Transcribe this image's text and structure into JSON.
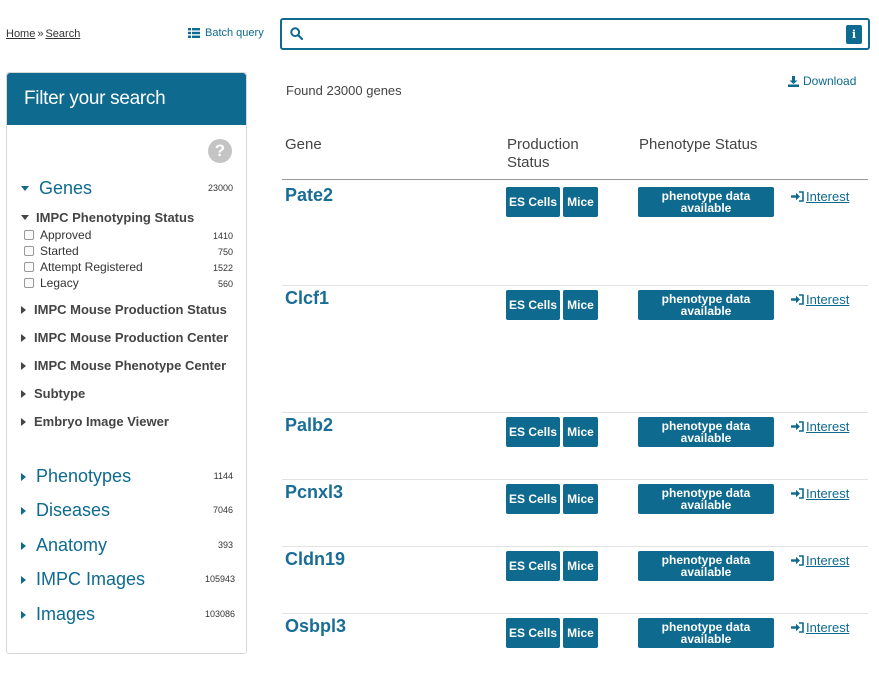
{
  "breadcrumb": {
    "home": "Home",
    "sep": "»",
    "current": "Search"
  },
  "batch_query": {
    "label": "Batch query",
    "icon": "list-icon"
  },
  "search": {
    "value": "",
    "placeholder": "",
    "info_label": "i"
  },
  "filter": {
    "title": "Filter your search",
    "help_label": "?",
    "genes": {
      "label": "Genes",
      "count": "23000"
    },
    "phenotyping_status": {
      "label": "IMPC Phenotyping Status",
      "options": [
        {
          "label": "Approved",
          "count": "1410"
        },
        {
          "label": "Started",
          "count": "750"
        },
        {
          "label": "Attempt Registered",
          "count": "1522"
        },
        {
          "label": "Legacy",
          "count": "560"
        }
      ]
    },
    "subfilters": [
      "IMPC Mouse Production Status",
      "IMPC Mouse Production Center",
      "IMPC Mouse Phenotype Center",
      "Subtype",
      "Embryo Image Viewer"
    ],
    "cores": [
      {
        "label": "Phenotypes",
        "count": "1144"
      },
      {
        "label": "Diseases",
        "count": "7046"
      },
      {
        "label": "Anatomy",
        "count": "393"
      },
      {
        "label": "IMPC Images",
        "count": "105943"
      },
      {
        "label": "Images",
        "count": "103086"
      }
    ]
  },
  "results": {
    "found_text": "Found 23000 genes",
    "download_label": "Download",
    "columns": {
      "gene": "Gene",
      "production_line1": "Production",
      "production_line2": "Status",
      "phenotype": "Phenotype Status"
    },
    "rows": [
      {
        "gene": "Pate2",
        "es": "ES Cells",
        "mice": "Mice",
        "pheno_line1": "phenotype data",
        "pheno_line2": "available",
        "interest": "Interest"
      },
      {
        "gene": "Clcf1",
        "es": "ES Cells",
        "mice": "Mice",
        "pheno_line1": "phenotype data",
        "pheno_line2": "available",
        "interest": "Interest"
      },
      {
        "gene": "Palb2",
        "es": "ES Cells",
        "mice": "Mice",
        "pheno_line1": "phenotype data",
        "pheno_line2": "available",
        "interest": "Interest"
      },
      {
        "gene": "Pcnxl3",
        "es": "ES Cells",
        "mice": "Mice",
        "pheno_line1": "phenotype data",
        "pheno_line2": "available",
        "interest": "Interest"
      },
      {
        "gene": "Cldn19",
        "es": "ES Cells",
        "mice": "Mice",
        "pheno_line1": "phenotype data",
        "pheno_line2": "available",
        "interest": "Interest"
      },
      {
        "gene": "Osbpl3",
        "es": "ES Cells",
        "mice": "Mice",
        "pheno_line1": "phenotype data",
        "pheno_line2": "available",
        "interest": "Interest"
      }
    ]
  },
  "colors": {
    "accent": "#0e6a8e",
    "gene_link": "#1a6d94"
  }
}
